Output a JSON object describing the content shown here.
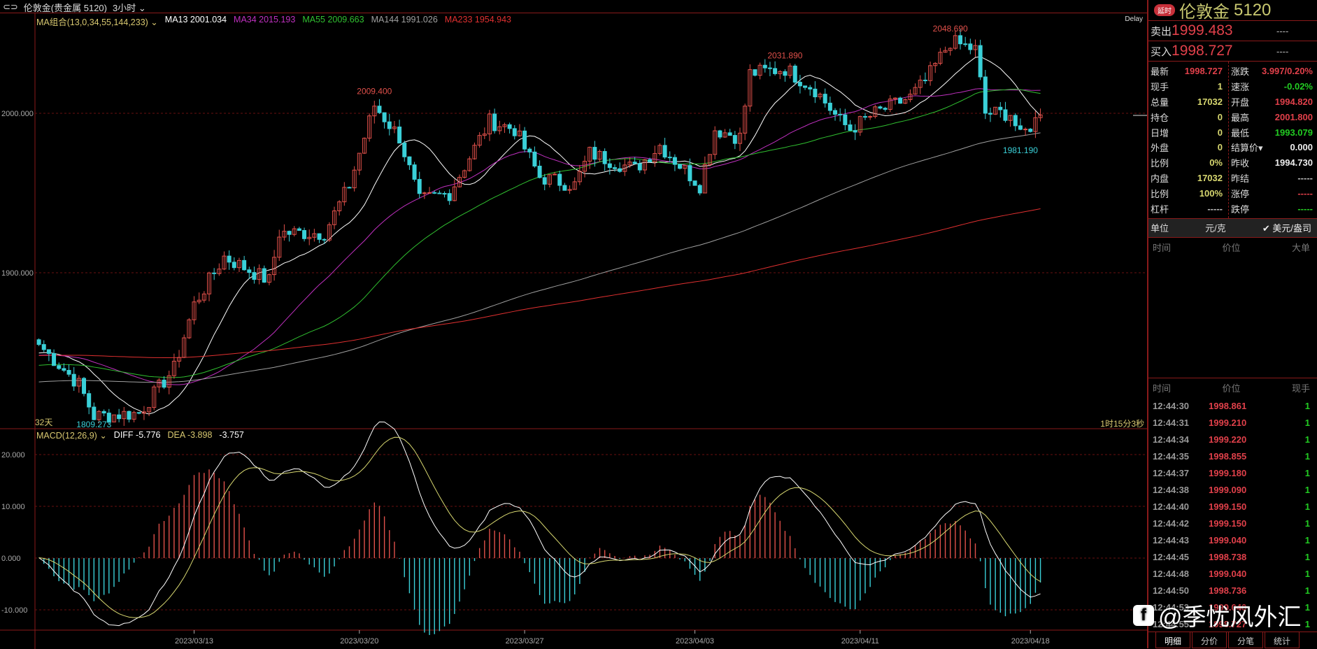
{
  "topbar": {
    "title": "伦敦金(贵金属 5120)",
    "period": "3小时"
  },
  "ma_legend": {
    "group": "MA组合(13,0,34,55,144,233)",
    "ma13": "MA13 2001.034",
    "ma34": "MA34 2015.193",
    "ma55": "MA55 2009.663",
    "ma144": "MA144 1991.026",
    "ma233": "MA233 1954.943"
  },
  "delay": "Delay",
  "days_label": "32天",
  "countdown": "1时15分3秒",
  "macd_legend": {
    "name": "MACD(12,26,9)",
    "diff": "DIFF -5.776",
    "dea": "DEA -3.898",
    "macd": "-3.757"
  },
  "colors": {
    "up": "#e0504a",
    "down": "#3ad0d8",
    "ma13": "#ffffff",
    "ma34": "#c030c0",
    "ma55": "#30c030",
    "ma144": "#a0a0a0",
    "ma233": "#e03030"
  },
  "chart_data": {
    "type": "candlestick",
    "bars": 200,
    "anchors": [
      [
        0,
        1855
      ],
      [
        8,
        1830
      ],
      [
        11,
        1810
      ],
      [
        20,
        1812
      ],
      [
        27,
        1840
      ],
      [
        31,
        1880
      ],
      [
        37,
        1910
      ],
      [
        46,
        1895
      ],
      [
        48,
        1925
      ],
      [
        57,
        1925
      ],
      [
        62,
        1955
      ],
      [
        67,
        2005
      ],
      [
        72,
        1985
      ],
      [
        76,
        1945
      ],
      [
        82,
        1950
      ],
      [
        90,
        1995
      ],
      [
        95,
        1990
      ],
      [
        100,
        1960
      ],
      [
        107,
        1955
      ],
      [
        110,
        1975
      ],
      [
        119,
        1965
      ],
      [
        124,
        1980
      ],
      [
        132,
        1955
      ],
      [
        135,
        1990
      ],
      [
        140,
        1985
      ],
      [
        142,
        2025
      ],
      [
        149,
        2028
      ],
      [
        155,
        2015
      ],
      [
        160,
        1995
      ],
      [
        162,
        1990
      ],
      [
        167,
        2000
      ],
      [
        174,
        2010
      ],
      [
        177,
        2020
      ],
      [
        182,
        2045
      ],
      [
        187,
        2040
      ],
      [
        189,
        2000
      ],
      [
        194,
        2000
      ],
      [
        196,
        1985
      ],
      [
        200,
        1999
      ]
    ],
    "y_ticks": [
      "2000.000",
      "1900.000"
    ],
    "y_tick_values": [
      2000,
      1900
    ],
    "macd_ticks": [
      "20.000",
      "10.000",
      "0.000",
      "-10.000"
    ],
    "macd_tick_values": [
      20,
      10,
      0,
      -10
    ],
    "x_labels": [
      "2023/03/13",
      "2023/03/20",
      "2023/03/27",
      "2023/04/03",
      "2023/04/11",
      "2023/04/18"
    ],
    "x_label_bars": [
      31,
      64,
      97,
      131,
      164,
      198
    ],
    "annotations": [
      {
        "text": "2009.400",
        "bar": 67,
        "price": 2009.4,
        "kind": "high"
      },
      {
        "text": "2031.890",
        "bar": 149,
        "price": 2031.89,
        "kind": "high"
      },
      {
        "text": "2048.690",
        "bar": 182,
        "price": 2048.69,
        "kind": "high"
      },
      {
        "text": "1981.190",
        "bar": 196,
        "price": 1981.19,
        "kind": "low"
      },
      {
        "text": "1809.273",
        "bar": 11,
        "price": 1809.273,
        "kind": "low"
      }
    ]
  },
  "quote": {
    "badge": "延时",
    "name": "伦敦金",
    "code": "5120",
    "sell_label": "卖出",
    "sell": "1999.483",
    "sell_vol": "----",
    "buy_label": "买入",
    "buy": "1998.727",
    "buy_vol": "----",
    "left": [
      {
        "k": "最新",
        "v": "1998.727",
        "c": "#e0404a"
      },
      {
        "k": "现手",
        "v": "1",
        "c": "#d8d870"
      },
      {
        "k": "总量",
        "v": "17032",
        "c": "#d8d870"
      },
      {
        "k": "持仓",
        "v": "0",
        "c": "#d8d870"
      },
      {
        "k": "日增",
        "v": "0",
        "c": "#d8d870"
      },
      {
        "k": "外盘",
        "v": "0",
        "c": "#d8d870"
      },
      {
        "k": "比例",
        "v": "0%",
        "c": "#d8d870"
      },
      {
        "k": "内盘",
        "v": "17032",
        "c": "#d8d870"
      },
      {
        "k": "比例",
        "v": "100%",
        "c": "#d8d870"
      },
      {
        "k": "杠杆",
        "v": "-----",
        "c": "#bbb"
      }
    ],
    "right": [
      {
        "k": "涨跌",
        "v": "3.997/0.20%",
        "c": "#e0404a"
      },
      {
        "k": "速涨",
        "v": "-0.02%",
        "c": "#2c2"
      },
      {
        "k": "开盘",
        "v": "1994.820",
        "c": "#e0404a"
      },
      {
        "k": "最高",
        "v": "2001.800",
        "c": "#e0404a"
      },
      {
        "k": "最低",
        "v": "1993.079",
        "c": "#2c2"
      },
      {
        "k": "结算价▾",
        "v": "0.000",
        "c": "#eee"
      },
      {
        "k": "昨收",
        "v": "1994.730",
        "c": "#eee"
      },
      {
        "k": "昨结",
        "v": "-----",
        "c": "#bbb"
      },
      {
        "k": "涨停",
        "v": "-----",
        "c": "#e0404a"
      },
      {
        "k": "跌停",
        "v": "-----",
        "c": "#2c2"
      }
    ],
    "unit_label": "单位",
    "unit_a": "元/克",
    "unit_b": "✔ 美元/盎司"
  },
  "big_orders": {
    "h_time": "时间",
    "h_price": "价位",
    "h_size": "大单"
  },
  "ticks": {
    "h_time": "时间",
    "h_price": "价位",
    "h_qty": "现手",
    "rows": [
      [
        "12:44:30",
        "1998.861",
        "1"
      ],
      [
        "12:44:31",
        "1999.210",
        "1"
      ],
      [
        "12:44:34",
        "1999.220",
        "1"
      ],
      [
        "12:44:35",
        "1998.855",
        "1"
      ],
      [
        "12:44:37",
        "1999.180",
        "1"
      ],
      [
        "12:44:38",
        "1999.090",
        "1"
      ],
      [
        "12:44:40",
        "1999.150",
        "1"
      ],
      [
        "12:44:42",
        "1999.150",
        "1"
      ],
      [
        "12:44:43",
        "1999.040",
        "1"
      ],
      [
        "12:44:45",
        "1998.738",
        "1"
      ],
      [
        "12:44:48",
        "1999.040",
        "1"
      ],
      [
        "12:44:50",
        "1998.736",
        "1"
      ],
      [
        "12:44:53",
        "1999.040",
        "1"
      ],
      [
        "12:44:55",
        "1998.727",
        "1"
      ]
    ]
  },
  "tabs": [
    "明细",
    "分价",
    "分笔",
    "统计"
  ],
  "watermark": "@季忧风外汇"
}
